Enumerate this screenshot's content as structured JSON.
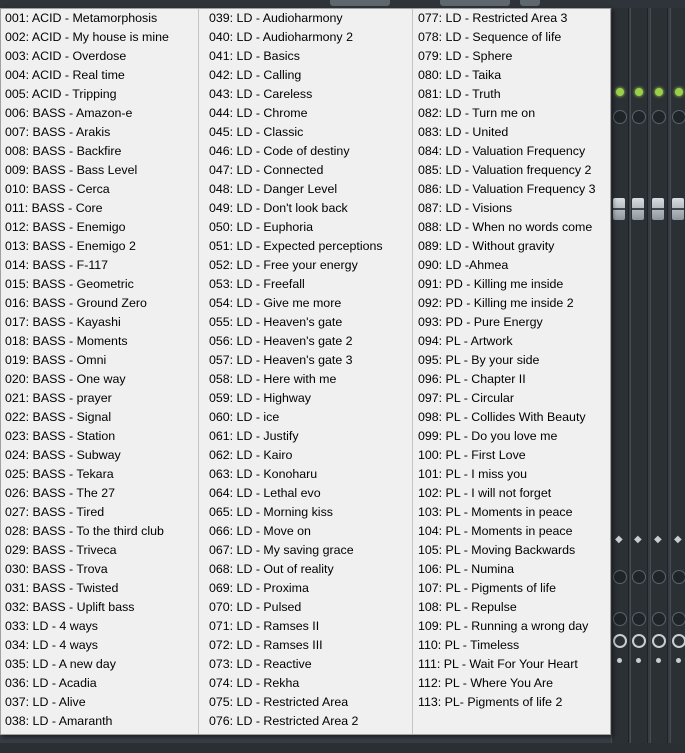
{
  "popup": {
    "columns": [
      {
        "items": [
          "001: ACID - Metamorphosis",
          "002: ACID - My house is mine",
          "003: ACID - Overdose",
          "004: ACID - Real time",
          "005: ACID - Tripping",
          "006: BASS - Amazon-e",
          "007: BASS - Arakis",
          "008: BASS - Backfire",
          "009: BASS - Bass Level",
          "010: BASS - Cerca",
          "011: BASS - Core",
          "012: BASS - Enemigo",
          "013: BASS - Enemigo 2",
          "014: BASS - F-117",
          "015: BASS - Geometric",
          "016: BASS - Ground Zero",
          "017: BASS - Kayashi",
          "018: BASS - Moments",
          "019: BASS - Omni",
          "020: BASS - One way",
          "021: BASS - prayer",
          "022: BASS - Signal",
          "023: BASS - Station",
          "024: BASS - Subway",
          "025: BASS - Tekara",
          "026: BASS - The 27",
          "027: BASS - Tired",
          "028: BASS - To the third club",
          "029: BASS - Triveca",
          "030: BASS - Trova",
          "031: BASS - Twisted",
          "032: BASS - Uplift bass",
          "033: LD - 4 ways",
          "034: LD - 4 ways",
          "035: LD - A new day",
          "036: LD - Acadia",
          "037: LD - Alive",
          "038: LD - Amaranth"
        ]
      },
      {
        "items": [
          "039: LD - Audioharmony",
          "040: LD - Audioharmony 2",
          "041: LD - Basics",
          "042: LD - Calling",
          "043: LD - Careless",
          "044: LD - Chrome",
          "045: LD - Classic",
          "046: LD - Code of destiny",
          "047: LD - Connected",
          "048: LD - Danger Level",
          "049: LD - Don't look back",
          "050: LD - Euphoria",
          "051: LD - Expected perceptions",
          "052: LD - Free your energy",
          "053: LD - Freefall",
          "054: LD - Give me more",
          "055: LD - Heaven's gate",
          "056: LD - Heaven's gate 2",
          "057: LD - Heaven's gate 3",
          "058: LD - Here with me",
          "059: LD - Highway",
          "060: LD - ice",
          "061: LD - Justify",
          "062: LD - Kairo",
          "063: LD - Konoharu",
          "064: LD - Lethal evo",
          "065: LD - Morning kiss",
          "066: LD - Move on",
          "067: LD - My saving grace",
          "068: LD - Out of reality",
          "069: LD - Proxima",
          "070: LD - Pulsed",
          "071: LD - Ramses II",
          "072: LD - Ramses III",
          "073: LD - Reactive",
          "074: LD - Rekha",
          "075: LD - Restricted Area",
          "076: LD - Restricted Area 2"
        ]
      },
      {
        "items": [
          "077: LD - Restricted Area 3",
          "078: LD - Sequence of life",
          "079: LD - Sphere",
          "080: LD - Taika",
          "081: LD - Truth",
          "082: LD - Turn me on",
          "083: LD - United",
          "084: LD - Valuation Frequency",
          "085: LD - Valuation frequency 2",
          "086: LD - Valuation Frequency 3",
          "087: LD - Visions",
          "088: LD - When no words come",
          "089: LD - Without gravity",
          "090: LD -Ahmea",
          "091: PD - Killing me inside",
          "092: PD - Killing me inside 2",
          "093: PD - Pure Energy",
          "094: PL - Artwork",
          "095: PL - By your side",
          "096: PL - Chapter II",
          "097: PL - Circular",
          "098: PL - Collides With Beauty",
          "099: PL - Do you love me",
          "100: PL - First Love",
          "101: PL - I miss you",
          "102: PL - I will not forget",
          "103: PL - Moments in peace",
          "104: PL - Moments in peace",
          "105: PL - Moving Backwards",
          "106: PL - Numina",
          "107: PL - Pigments of life",
          "108: PL - Repulse",
          "109: PL - Running a wrong day",
          "110: PL - Timeless",
          "111: PL - Wait For Your Heart",
          "112: PL - Where You Are",
          "113: PL- Pigments of life 2"
        ]
      }
    ]
  },
  "mixer": {
    "led_color": "#9ad04a",
    "background_color": "#363d44",
    "icons": [
      "knob-icon",
      "fader-icon",
      "pan-arrows-icon",
      "clock-icon"
    ]
  }
}
